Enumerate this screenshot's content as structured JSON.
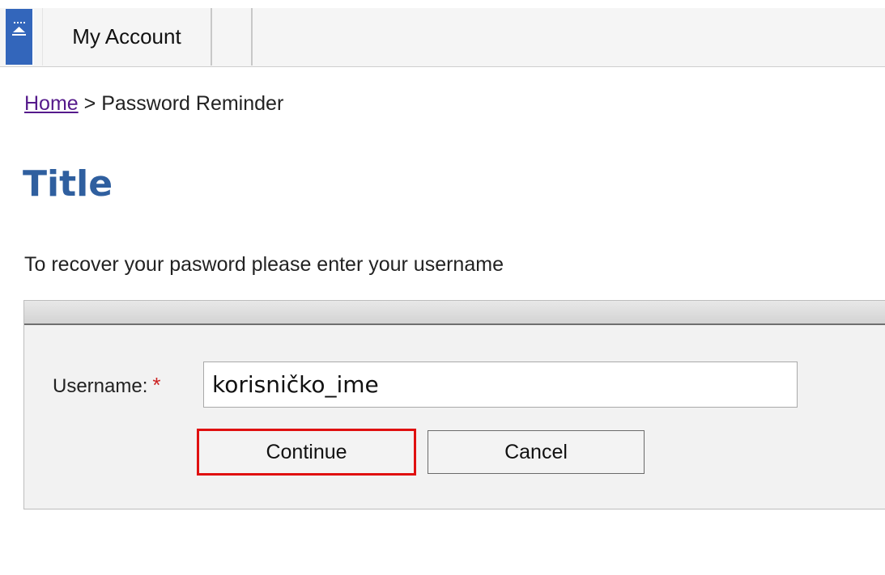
{
  "nav": {
    "tab_label": "My Account"
  },
  "breadcrumb": {
    "home": "Home",
    "separator": " > ",
    "current": "Password Reminder"
  },
  "page": {
    "title": "Title",
    "instructions": "To recover your pasword please enter your username"
  },
  "form": {
    "username_label": "Username:",
    "required_marker": "*",
    "username_value": "korisničko_ime",
    "continue_label": "Continue",
    "cancel_label": "Cancel"
  },
  "colors": {
    "title": "#2f5f9f",
    "logo": "#3366bb",
    "highlight": "#e01010"
  }
}
